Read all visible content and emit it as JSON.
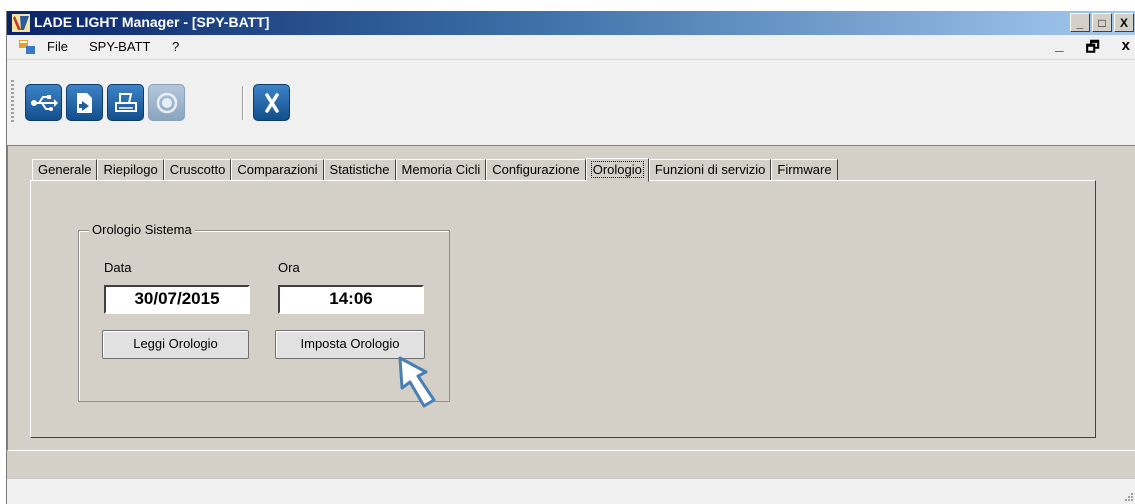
{
  "window": {
    "title": "LADE LIGHT Manager - [SPY-BATT]",
    "controls": {
      "minimize": "_",
      "maximize": "□",
      "close": "X"
    }
  },
  "menu": {
    "items": [
      "File",
      "SPY-BATT",
      "?"
    ],
    "mdi_minimize": "_",
    "mdi_restore": "ₐ",
    "mdi_close": "x"
  },
  "toolbar": {
    "buttons": [
      {
        "icon": "usb-icon",
        "enabled": true
      },
      {
        "icon": "load-file-icon",
        "enabled": true
      },
      {
        "icon": "printer-icon",
        "enabled": true
      },
      {
        "icon": "record-icon",
        "enabled": false
      },
      {
        "icon": "exit-icon",
        "enabled": true
      }
    ]
  },
  "tabs": {
    "items": [
      "Generale",
      "Riepilogo",
      "Cruscotto",
      "Comparazioni",
      "Statistiche",
      "Memoria Cicli",
      "Configurazione",
      "Orologio",
      "Funzioni di servizio",
      "Firmware"
    ],
    "active": "Orologio"
  },
  "clock": {
    "group_title": "Orologio Sistema",
    "date_label": "Data",
    "time_label": "Ora",
    "date_value": "30/07/2015",
    "time_value": "14:06",
    "read_button": "Leggi Orologio",
    "set_button": "Imposta Orologio"
  },
  "colors": {
    "title_gradient_start": "#0a246a",
    "title_gradient_end": "#a6caf0",
    "toolbar_button": "#2468ad",
    "pointer": "#4a7fb5"
  }
}
